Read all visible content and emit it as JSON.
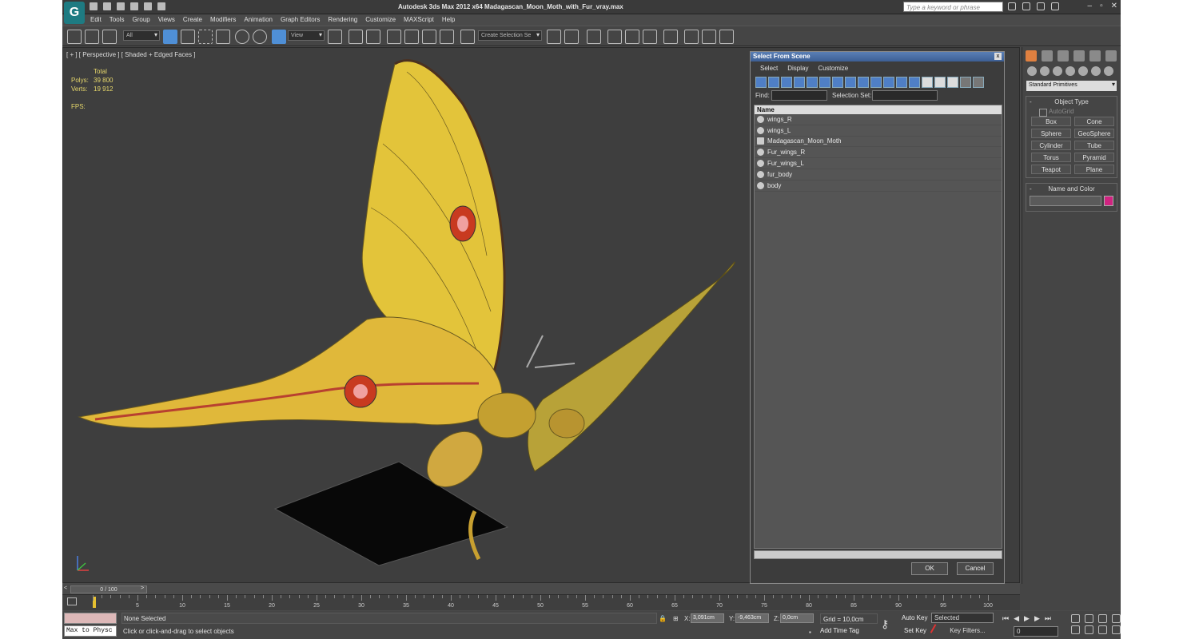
{
  "window": {
    "title": "Autodesk 3ds Max  2012 x64     Madagascan_Moon_Moth_with_Fur_vray.max",
    "search_placeholder": "Type a keyword or phrase",
    "logo_icon": "3ds-max-logo-icon"
  },
  "menu": [
    "Edit",
    "Tools",
    "Group",
    "Views",
    "Create",
    "Modifiers",
    "Animation",
    "Graph Editors",
    "Rendering",
    "Customize",
    "MAXScript",
    "Help"
  ],
  "toolbar": {
    "filter_value": "All",
    "refcoord_value": "View",
    "selection_set_value": "Create Selection Se"
  },
  "viewport": {
    "label": "[ + ] [ Perspective ] [ Shaded + Edged Faces ]",
    "stats_header": "Total",
    "polys_label": "Polys:",
    "polys_value": "39 800",
    "verts_label": "Verts:",
    "verts_value": "19 912",
    "fps_label": "FPS:"
  },
  "select_dialog": {
    "title": "Select From Scene",
    "menu": [
      "Select",
      "Display",
      "Customize"
    ],
    "find_label": "Find:",
    "selection_set_label": "Selection Set:",
    "column_name": "Name",
    "items": [
      "wings_R",
      "wings_L",
      "Madagascan_Moon_Moth",
      "Fur_wings_R",
      "Fur_wings_L",
      "fur_body",
      "body"
    ],
    "ok_label": "OK",
    "cancel_label": "Cancel"
  },
  "command_panel": {
    "category": "Standard Primitives",
    "object_type_title": "Object Type",
    "autogrid_label": "AutoGrid",
    "object_types": [
      "Box",
      "Cone",
      "Sphere",
      "GeoSphere",
      "Cylinder",
      "Tube",
      "Torus",
      "Pyramid",
      "Teapot",
      "Plane"
    ],
    "name_color_title": "Name and Color",
    "object_color": "#d02380"
  },
  "timeline": {
    "frame_display": "0 / 100",
    "ticks": [
      5,
      10,
      15,
      20,
      25,
      30,
      35,
      40,
      45,
      50,
      55,
      60,
      65,
      70,
      75,
      80,
      85,
      90,
      95,
      100
    ]
  },
  "status": {
    "maxscript_text": "Max to Physc",
    "selection_text": "None Selected",
    "prompt_text": "Click or click-and-drag to select objects",
    "x_label": "X:",
    "x_value": "3,091cm",
    "y_label": "Y:",
    "y_value": "-9,463cm",
    "z_label": "Z:",
    "z_value": "0,0cm",
    "grid_text": "Grid = 10,0cm",
    "add_time_tag": "Add Time Tag",
    "auto_key": "Auto Key",
    "set_key": "Set Key",
    "selected_value": "Selected",
    "key_filters": "Key Filters...",
    "frame_value": "0"
  }
}
